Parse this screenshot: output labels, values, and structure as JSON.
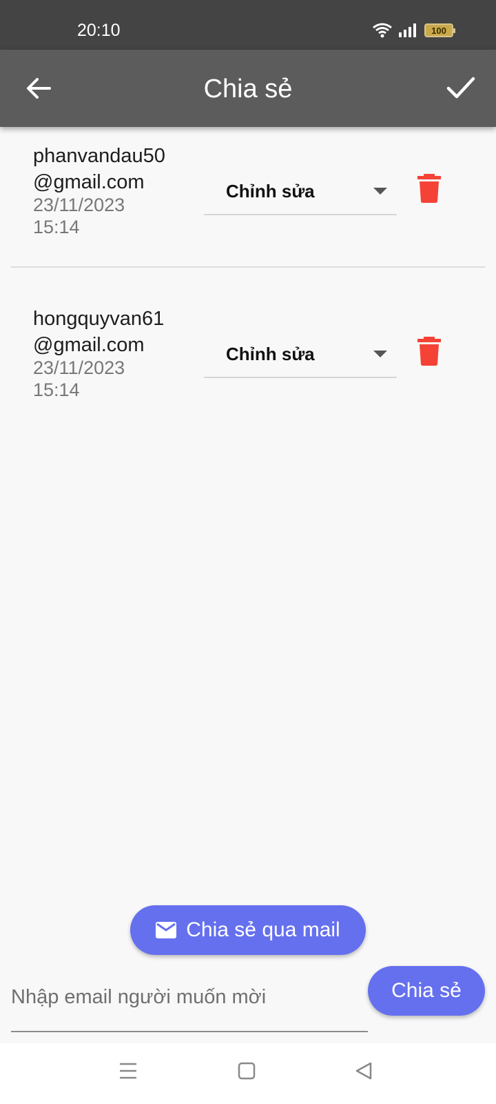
{
  "status_bar": {
    "time": "20:10",
    "battery": "100",
    "icons": [
      "wifi-icon",
      "signal-icon",
      "battery-icon"
    ]
  },
  "app_bar": {
    "title": "Chia sẻ",
    "back_icon": "arrow-left-icon",
    "confirm_icon": "check-icon"
  },
  "shares": [
    {
      "email_line1": "phanvandau50",
      "email_line2": "@gmail.com",
      "date": "23/11/2023",
      "time": "15:14",
      "permission": "Chỉnh sửa"
    },
    {
      "email_line1": "hongquyvan61",
      "email_line2": "@gmail.com",
      "date": "23/11/2023",
      "time": "15:14",
      "permission": "Chỉnh sửa"
    }
  ],
  "actions": {
    "mail_share_label": "Chia sẻ qua mail",
    "email_placeholder": "Nhập email người muốn mời",
    "share_label": "Chia sẻ"
  },
  "colors": {
    "accent": "#6570ee",
    "delete": "#f44336",
    "app_bar": "#5c5c5c",
    "status_bar": "#444444"
  }
}
